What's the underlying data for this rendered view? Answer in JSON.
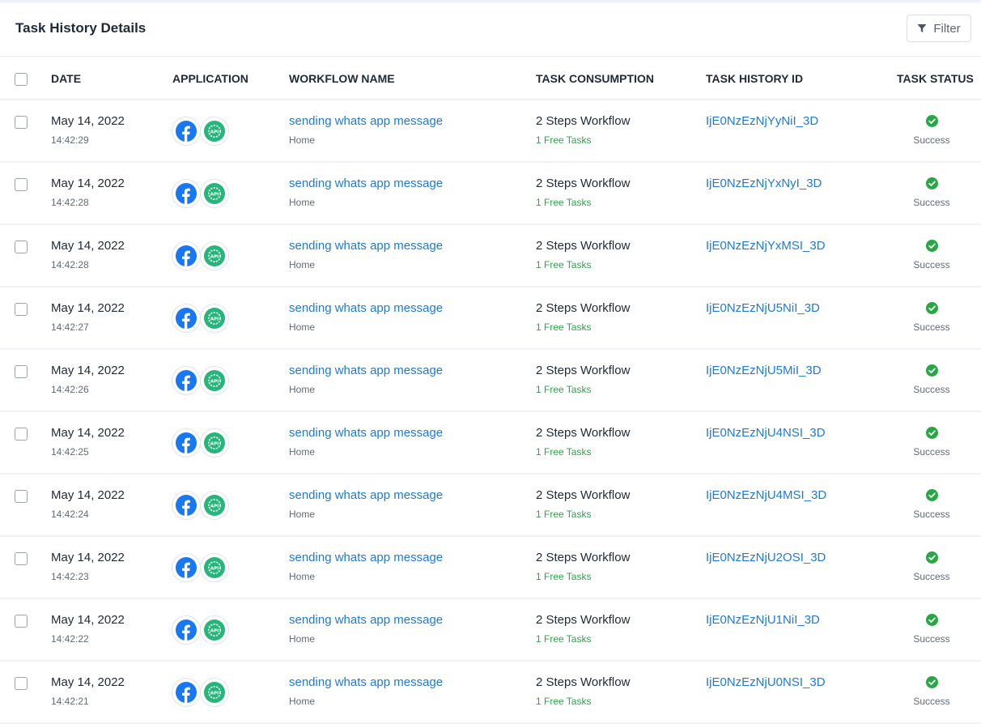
{
  "page": {
    "title": "Task History Details",
    "filter_label": "Filter"
  },
  "colors": {
    "link": "#1e7ad6",
    "success": "#28a745",
    "facebook": "#1877f2",
    "api": "#27b67a"
  },
  "columns": {
    "date": "DATE",
    "application": "APPLICATION",
    "workflow_name": "WORKFLOW NAME",
    "task_consumption": "TASK CONSUMPTION",
    "task_history_id": "TASK HISTORY ID",
    "task_status": "TASK STATUS"
  },
  "rows": [
    {
      "date": "May 14, 2022",
      "time": "14:42:29",
      "apps": [
        "facebook-icon",
        "api-icon"
      ],
      "workflow": "sending whats app message",
      "folder": "Home",
      "consumption": "2 Steps Workflow",
      "free_tasks": "1 Free Tasks",
      "history_id": "IjE0NzEzNjYyNiI_3D",
      "status": "Success"
    },
    {
      "date": "May 14, 2022",
      "time": "14:42:28",
      "apps": [
        "facebook-icon",
        "api-icon"
      ],
      "workflow": "sending whats app message",
      "folder": "Home",
      "consumption": "2 Steps Workflow",
      "free_tasks": "1 Free Tasks",
      "history_id": "IjE0NzEzNjYxNyI_3D",
      "status": "Success"
    },
    {
      "date": "May 14, 2022",
      "time": "14:42:28",
      "apps": [
        "facebook-icon",
        "api-icon"
      ],
      "workflow": "sending whats app message",
      "folder": "Home",
      "consumption": "2 Steps Workflow",
      "free_tasks": "1 Free Tasks",
      "history_id": "IjE0NzEzNjYxMSI_3D",
      "status": "Success"
    },
    {
      "date": "May 14, 2022",
      "time": "14:42:27",
      "apps": [
        "facebook-icon",
        "api-icon"
      ],
      "workflow": "sending whats app message",
      "folder": "Home",
      "consumption": "2 Steps Workflow",
      "free_tasks": "1 Free Tasks",
      "history_id": "IjE0NzEzNjU5NiI_3D",
      "status": "Success"
    },
    {
      "date": "May 14, 2022",
      "time": "14:42:26",
      "apps": [
        "facebook-icon",
        "api-icon"
      ],
      "workflow": "sending whats app message",
      "folder": "Home",
      "consumption": "2 Steps Workflow",
      "free_tasks": "1 Free Tasks",
      "history_id": "IjE0NzEzNjU5MiI_3D",
      "status": "Success"
    },
    {
      "date": "May 14, 2022",
      "time": "14:42:25",
      "apps": [
        "facebook-icon",
        "api-icon"
      ],
      "workflow": "sending whats app message",
      "folder": "Home",
      "consumption": "2 Steps Workflow",
      "free_tasks": "1 Free Tasks",
      "history_id": "IjE0NzEzNjU4NSI_3D",
      "status": "Success"
    },
    {
      "date": "May 14, 2022",
      "time": "14:42:24",
      "apps": [
        "facebook-icon",
        "api-icon"
      ],
      "workflow": "sending whats app message",
      "folder": "Home",
      "consumption": "2 Steps Workflow",
      "free_tasks": "1 Free Tasks",
      "history_id": "IjE0NzEzNjU4MSI_3D",
      "status": "Success"
    },
    {
      "date": "May 14, 2022",
      "time": "14:42:23",
      "apps": [
        "facebook-icon",
        "api-icon"
      ],
      "workflow": "sending whats app message",
      "folder": "Home",
      "consumption": "2 Steps Workflow",
      "free_tasks": "1 Free Tasks",
      "history_id": "IjE0NzEzNjU2OSI_3D",
      "status": "Success"
    },
    {
      "date": "May 14, 2022",
      "time": "14:42:22",
      "apps": [
        "facebook-icon",
        "api-icon"
      ],
      "workflow": "sending whats app message",
      "folder": "Home",
      "consumption": "2 Steps Workflow",
      "free_tasks": "1 Free Tasks",
      "history_id": "IjE0NzEzNjU1NiI_3D",
      "status": "Success"
    },
    {
      "date": "May 14, 2022",
      "time": "14:42:21",
      "apps": [
        "facebook-icon",
        "api-icon"
      ],
      "workflow": "sending whats app message",
      "folder": "Home",
      "consumption": "2 Steps Workflow",
      "free_tasks": "1 Free Tasks",
      "history_id": "IjE0NzEzNjU0NSI_3D",
      "status": "Success"
    }
  ]
}
